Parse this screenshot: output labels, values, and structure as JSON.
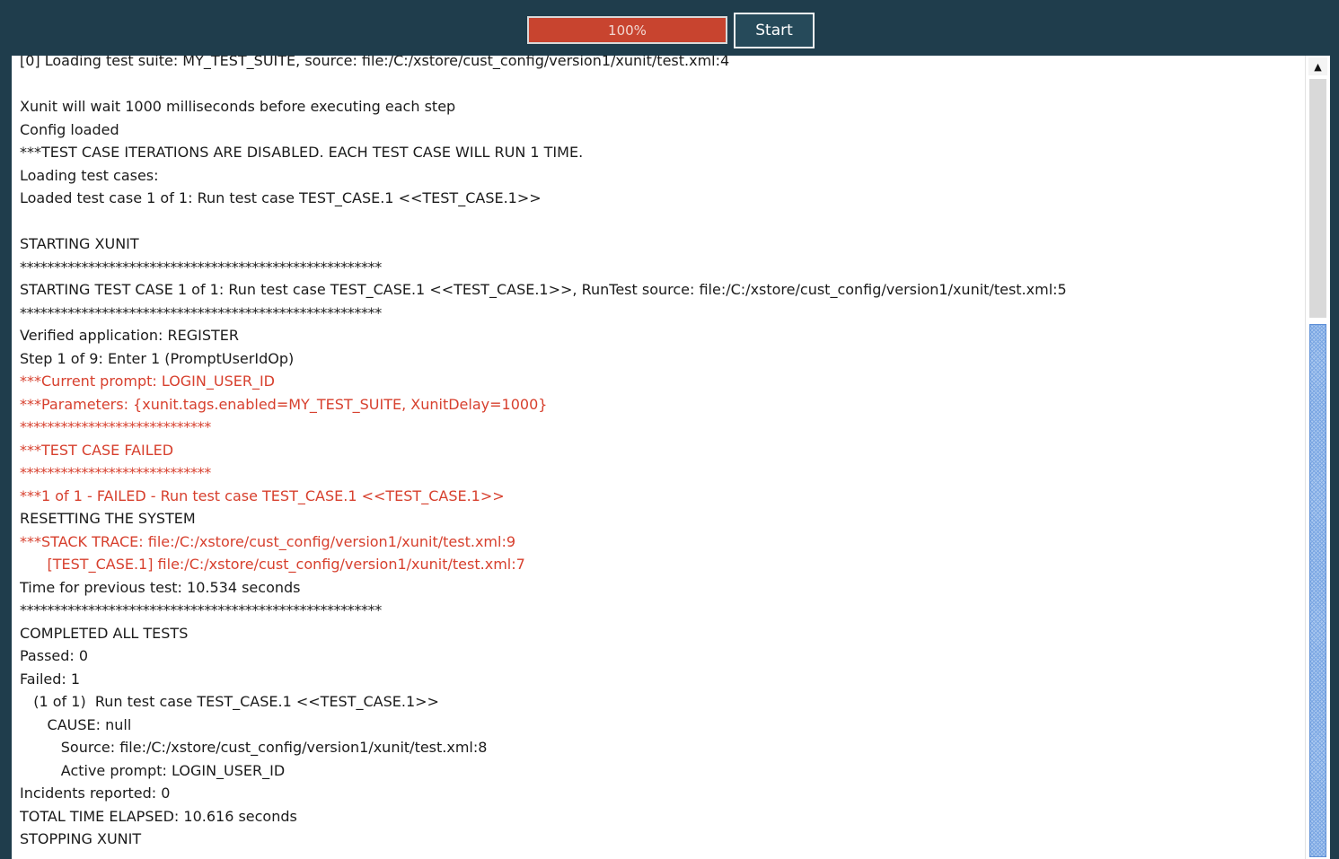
{
  "toolbar": {
    "progress_label": "100%",
    "progress_value": 1.0,
    "start_label": "Start"
  },
  "colors": {
    "background": "#1f3d4c",
    "progress_fill": "#c8442f",
    "error_text": "#d7402e",
    "scroll_thumb": "#aac8f0"
  },
  "scrollbar": {
    "up_icon": "triangle-up-icon"
  },
  "log": {
    "lines": [
      {
        "text": "[0] Loading test suite: MY_TEST_SUITE, source: file:/C:/xstore/cust_config/version1/xunit/test.xml:4",
        "kind": "normal"
      },
      {
        "text": "",
        "kind": "normal"
      },
      {
        "text": "Xunit will wait 1000 milliseconds before executing each step",
        "kind": "normal"
      },
      {
        "text": "Config loaded",
        "kind": "normal"
      },
      {
        "text": "***TEST CASE ITERATIONS ARE DISABLED. EACH TEST CASE WILL RUN 1 TIME.",
        "kind": "normal"
      },
      {
        "text": "Loading test cases:",
        "kind": "normal"
      },
      {
        "text": "Loaded test case 1 of 1: Run test case TEST_CASE.1 <<TEST_CASE.1>>",
        "kind": "normal"
      },
      {
        "text": "",
        "kind": "normal"
      },
      {
        "text": "STARTING XUNIT",
        "kind": "normal"
      },
      {
        "text": "*****************************************************",
        "kind": "stars"
      },
      {
        "text": "STARTING TEST CASE 1 of 1: Run test case TEST_CASE.1 <<TEST_CASE.1>>, RunTest source: file:/C:/xstore/cust_config/version1/xunit/test.xml:5",
        "kind": "normal"
      },
      {
        "text": "*****************************************************",
        "kind": "stars"
      },
      {
        "text": "Verified application: REGISTER",
        "kind": "normal"
      },
      {
        "text": "Step 1 of 9: Enter 1 (PromptUserIdOp)",
        "kind": "normal"
      },
      {
        "text": "***Current prompt: LOGIN_USER_ID",
        "kind": "err"
      },
      {
        "text": "***Parameters: {xunit.tags.enabled=MY_TEST_SUITE, XunitDelay=1000}",
        "kind": "err"
      },
      {
        "text": "****************************",
        "kind": "err stars"
      },
      {
        "text": "***TEST CASE FAILED",
        "kind": "err"
      },
      {
        "text": "****************************",
        "kind": "err stars"
      },
      {
        "text": "***1 of 1 - FAILED - Run test case TEST_CASE.1 <<TEST_CASE.1>>",
        "kind": "err"
      },
      {
        "text": "RESETTING THE SYSTEM",
        "kind": "normal"
      },
      {
        "text": "***STACK TRACE: file:/C:/xstore/cust_config/version1/xunit/test.xml:9",
        "kind": "err"
      },
      {
        "text": "      [TEST_CASE.1] file:/C:/xstore/cust_config/version1/xunit/test.xml:7",
        "kind": "err"
      },
      {
        "text": "Time for previous test: 10.534 seconds",
        "kind": "normal"
      },
      {
        "text": "*****************************************************",
        "kind": "stars"
      },
      {
        "text": "COMPLETED ALL TESTS",
        "kind": "normal"
      },
      {
        "text": "Passed: 0",
        "kind": "normal"
      },
      {
        "text": "Failed: 1",
        "kind": "normal"
      },
      {
        "text": "   (1 of 1)  Run test case TEST_CASE.1 <<TEST_CASE.1>>",
        "kind": "normal"
      },
      {
        "text": "      CAUSE: null",
        "kind": "normal"
      },
      {
        "text": "         Source: file:/C:/xstore/cust_config/version1/xunit/test.xml:8",
        "kind": "normal"
      },
      {
        "text": "         Active prompt: LOGIN_USER_ID",
        "kind": "normal"
      },
      {
        "text": "Incidents reported: 0",
        "kind": "normal"
      },
      {
        "text": "TOTAL TIME ELAPSED: 10.616 seconds",
        "kind": "normal"
      },
      {
        "text": "STOPPING XUNIT",
        "kind": "normal"
      }
    ]
  }
}
